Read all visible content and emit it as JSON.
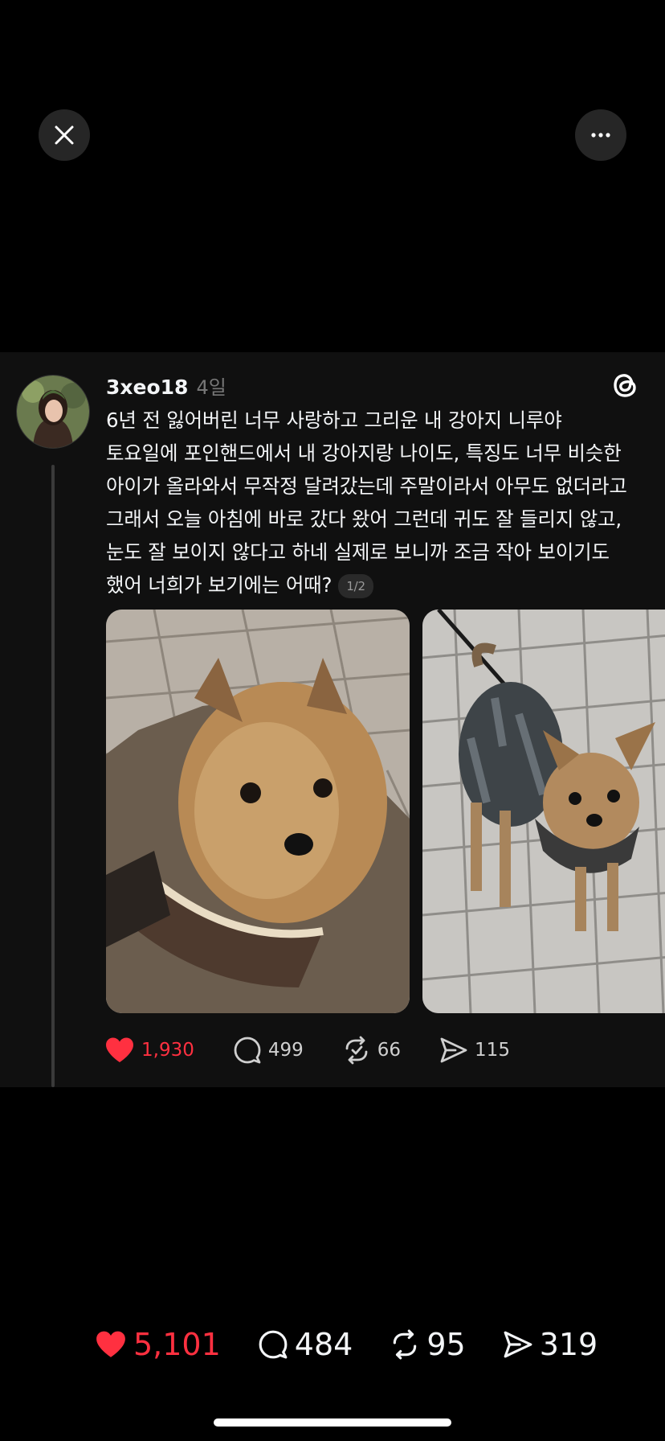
{
  "post": {
    "username": "3xeo18",
    "time": "4일",
    "text": "6년 전 잃어버린 너무 사랑하고 그리운 내 강아지 니루야\n토요일에 포인핸드에서 내 강아지랑 나이도, 특징도 너무 비슷한\n아이가 올라와서 무작정 달려갔는데 주말이라서 아무도 없더라고\n그래서 오늘 아침에 바로 갔다 왔어 그런데 귀도 잘 들리지 않고,\n눈도 잘 보이지 않다고 하네 실제로 보니까 조금 작아 보이기도\n했어 너희가 보기에는 어때?",
    "image_counter": "1/2",
    "actions": {
      "likes": "1,930",
      "comments": "499",
      "reposts": "66",
      "shares": "115"
    }
  },
  "bottom_bar": {
    "likes": "5,101",
    "comments": "484",
    "reposts": "95",
    "shares": "319"
  },
  "colors": {
    "like": "#ff3040",
    "background": "#000000",
    "post_background": "#101010"
  },
  "icons": [
    "close-icon",
    "more-icon",
    "threads-logo-icon",
    "heart-icon",
    "comment-icon",
    "repost-icon",
    "share-icon"
  ]
}
